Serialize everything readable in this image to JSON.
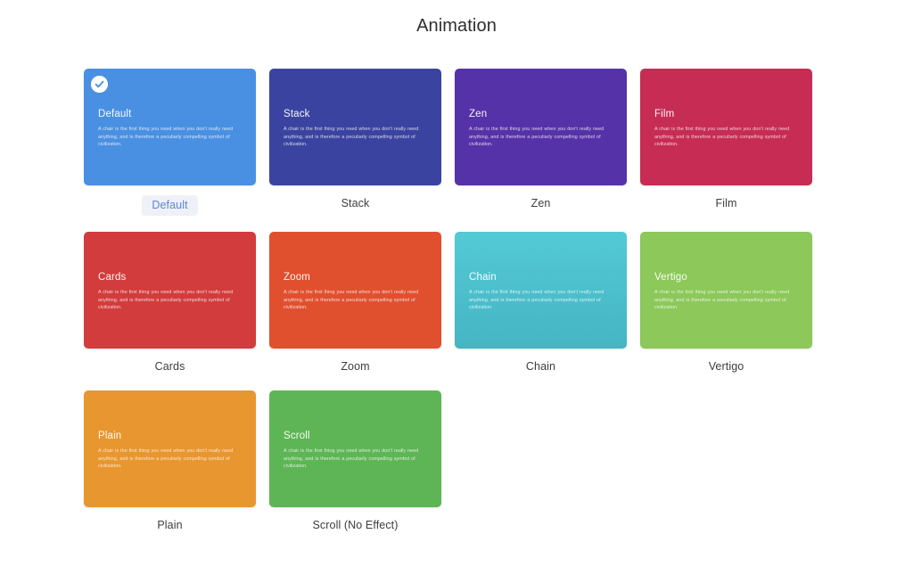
{
  "header": {
    "title": "Animation"
  },
  "card_body_text": "A chair is the first thing you need when you don't really need anything, and is therefore a peculiarly compelling symbol of civilization.",
  "icons": {
    "check": "check-circle-icon"
  },
  "colors": {
    "default": "#4a90e2",
    "stack": "#3a44a0",
    "zen": "#5632a8",
    "film": "#c72c54",
    "cards": "#d23c3c",
    "zoom": "#e0502f",
    "chain_top": "#53cad6",
    "chain_bottom": "#45b5c2",
    "vertigo": "#8cc85a",
    "plain": "#e8962f",
    "scroll": "#5eb555",
    "selected_badge_bg": "#eef1f7",
    "selected_badge_text": "#5a86d8",
    "page_bg": "#ffffff",
    "title_text": "#2e2e2e",
    "label_text": "#3d3d3d"
  },
  "items": [
    {
      "id": "default",
      "card_title": "Default",
      "label": "Default",
      "selected": true,
      "color": "#4a90e2"
    },
    {
      "id": "stack",
      "card_title": "Stack",
      "label": "Stack",
      "selected": false,
      "color": "#3a44a0"
    },
    {
      "id": "zen",
      "card_title": "Zen",
      "label": "Zen",
      "selected": false,
      "color": "#5632a8"
    },
    {
      "id": "film",
      "card_title": "Film",
      "label": "Film",
      "selected": false,
      "color": "#c72c54"
    },
    {
      "id": "cards",
      "card_title": "Cards",
      "label": "Cards",
      "selected": false,
      "color": "#d23c3c"
    },
    {
      "id": "zoom",
      "card_title": "Zoom",
      "label": "Zoom",
      "selected": false,
      "color": "#e0502f"
    },
    {
      "id": "chain",
      "card_title": "Chain",
      "label": "Chain",
      "selected": false,
      "color": "#53cad6"
    },
    {
      "id": "vertigo",
      "card_title": "Vertigo",
      "label": "Vertigo",
      "selected": false,
      "color": "#8cc85a"
    },
    {
      "id": "plain",
      "card_title": "Plain",
      "label": "Plain",
      "selected": false,
      "color": "#e8962f"
    },
    {
      "id": "scroll",
      "card_title": "Scroll",
      "label": "Scroll (No Effect)",
      "selected": false,
      "color": "#5eb555"
    }
  ]
}
